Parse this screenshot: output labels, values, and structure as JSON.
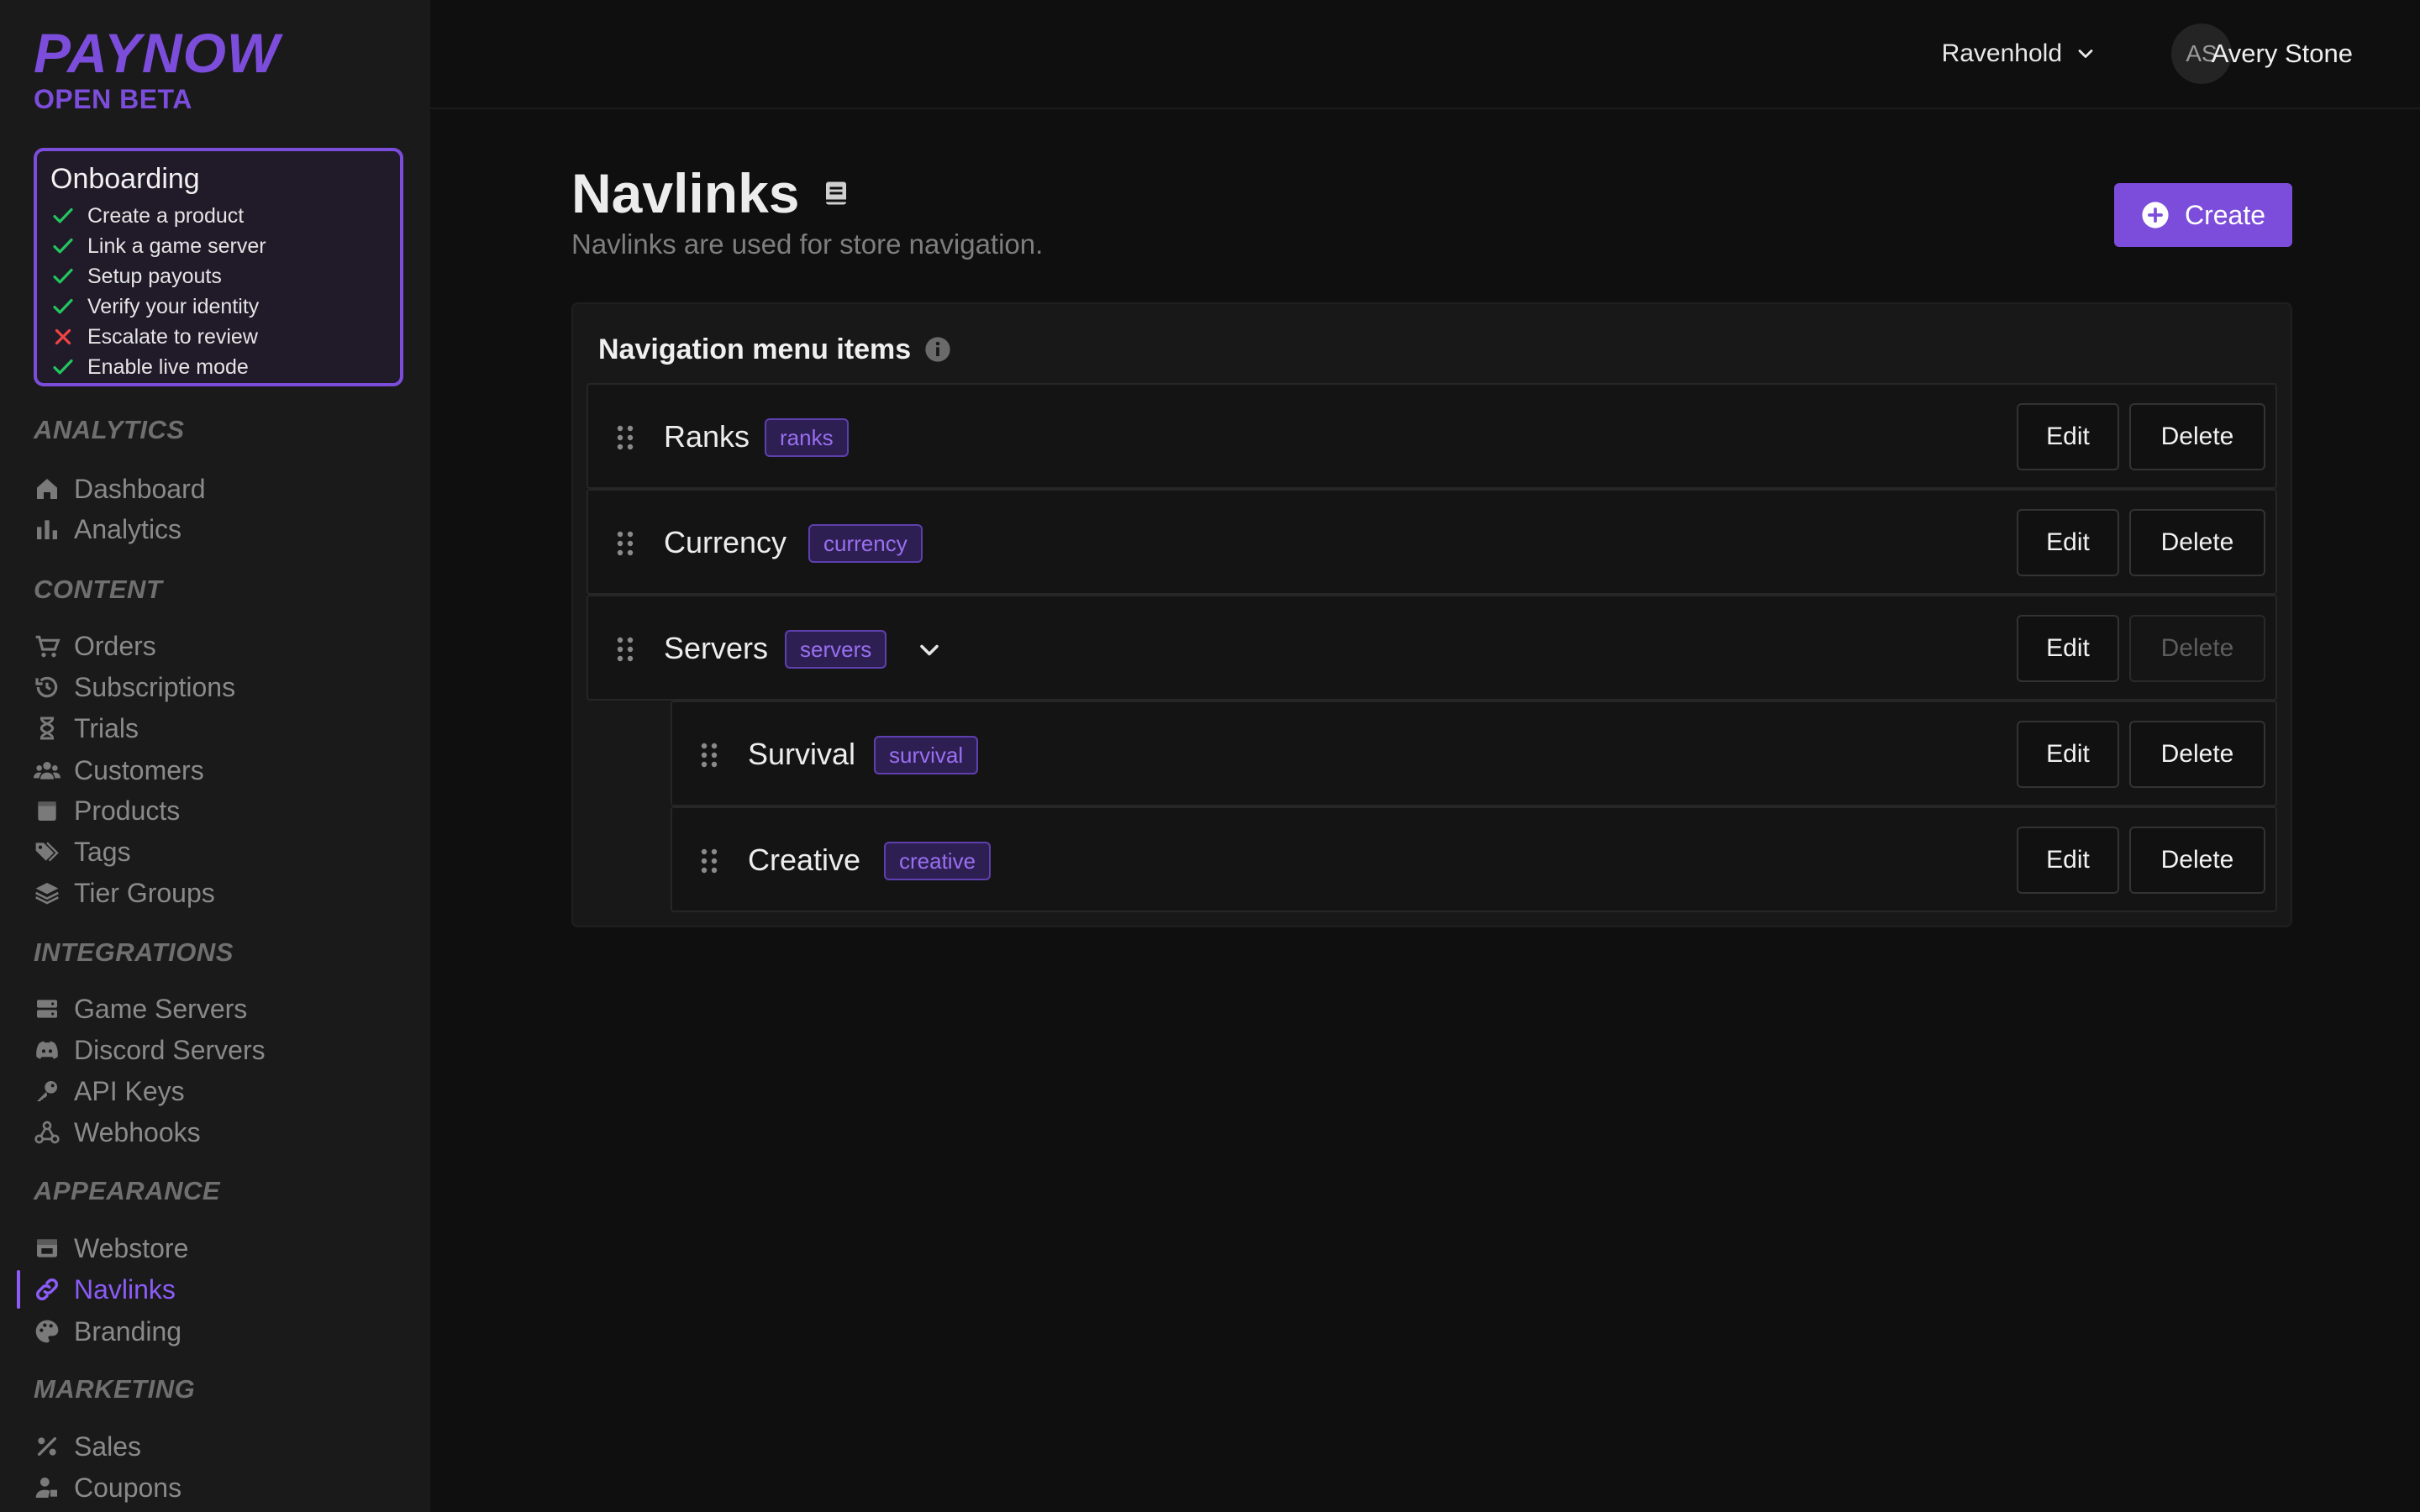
{
  "brand": {
    "name": "PAYNOW",
    "sub": "OPEN BETA"
  },
  "onboarding": {
    "title": "Onboarding",
    "items": [
      {
        "label": "Create a product",
        "status": "done"
      },
      {
        "label": "Link a game server",
        "status": "done"
      },
      {
        "label": "Setup payouts",
        "status": "done"
      },
      {
        "label": "Verify your identity",
        "status": "done"
      },
      {
        "label": "Escalate to review",
        "status": "failed"
      },
      {
        "label": "Enable live mode",
        "status": "done"
      }
    ]
  },
  "sidebar": {
    "analytics_title": "ANALYTICS",
    "dashboard": "Dashboard",
    "analytics": "Analytics",
    "content_title": "CONTENT",
    "orders": "Orders",
    "subscriptions": "Subscriptions",
    "trials": "Trials",
    "customers": "Customers",
    "products": "Products",
    "tags": "Tags",
    "tier_groups": "Tier Groups",
    "integrations_title": "INTEGRATIONS",
    "game_servers": "Game Servers",
    "discord_servers": "Discord Servers",
    "api_keys": "API Keys",
    "webhooks": "Webhooks",
    "appearance_title": "APPEARANCE",
    "webstore": "Webstore",
    "navlinks": "Navlinks",
    "branding": "Branding",
    "marketing_title": "MARKETING",
    "sales": "Sales",
    "coupons": "Coupons"
  },
  "topbar": {
    "store": "Ravenhold",
    "avatar_initials": "AS",
    "user_name": "Avery Stone"
  },
  "page": {
    "title": "Navlinks",
    "subtitle": "Navlinks are used for store navigation.",
    "create_label": "Create",
    "panel_title": "Navigation menu items"
  },
  "rows": [
    {
      "label": "Ranks",
      "tag": "ranks",
      "edit": "Edit",
      "delete": "Delete"
    },
    {
      "label": "Currency",
      "tag": "currency",
      "edit": "Edit",
      "delete": "Delete"
    },
    {
      "label": "Servers",
      "tag": "servers",
      "edit": "Edit",
      "delete": "Delete"
    },
    {
      "label": "Survival",
      "tag": "survival",
      "edit": "Edit",
      "delete": "Delete"
    },
    {
      "label": "Creative",
      "tag": "creative",
      "edit": "Edit",
      "delete": "Delete"
    }
  ],
  "colors": {
    "accent": "#7c4ddb",
    "success": "#22c55e",
    "danger": "#ef4444"
  }
}
